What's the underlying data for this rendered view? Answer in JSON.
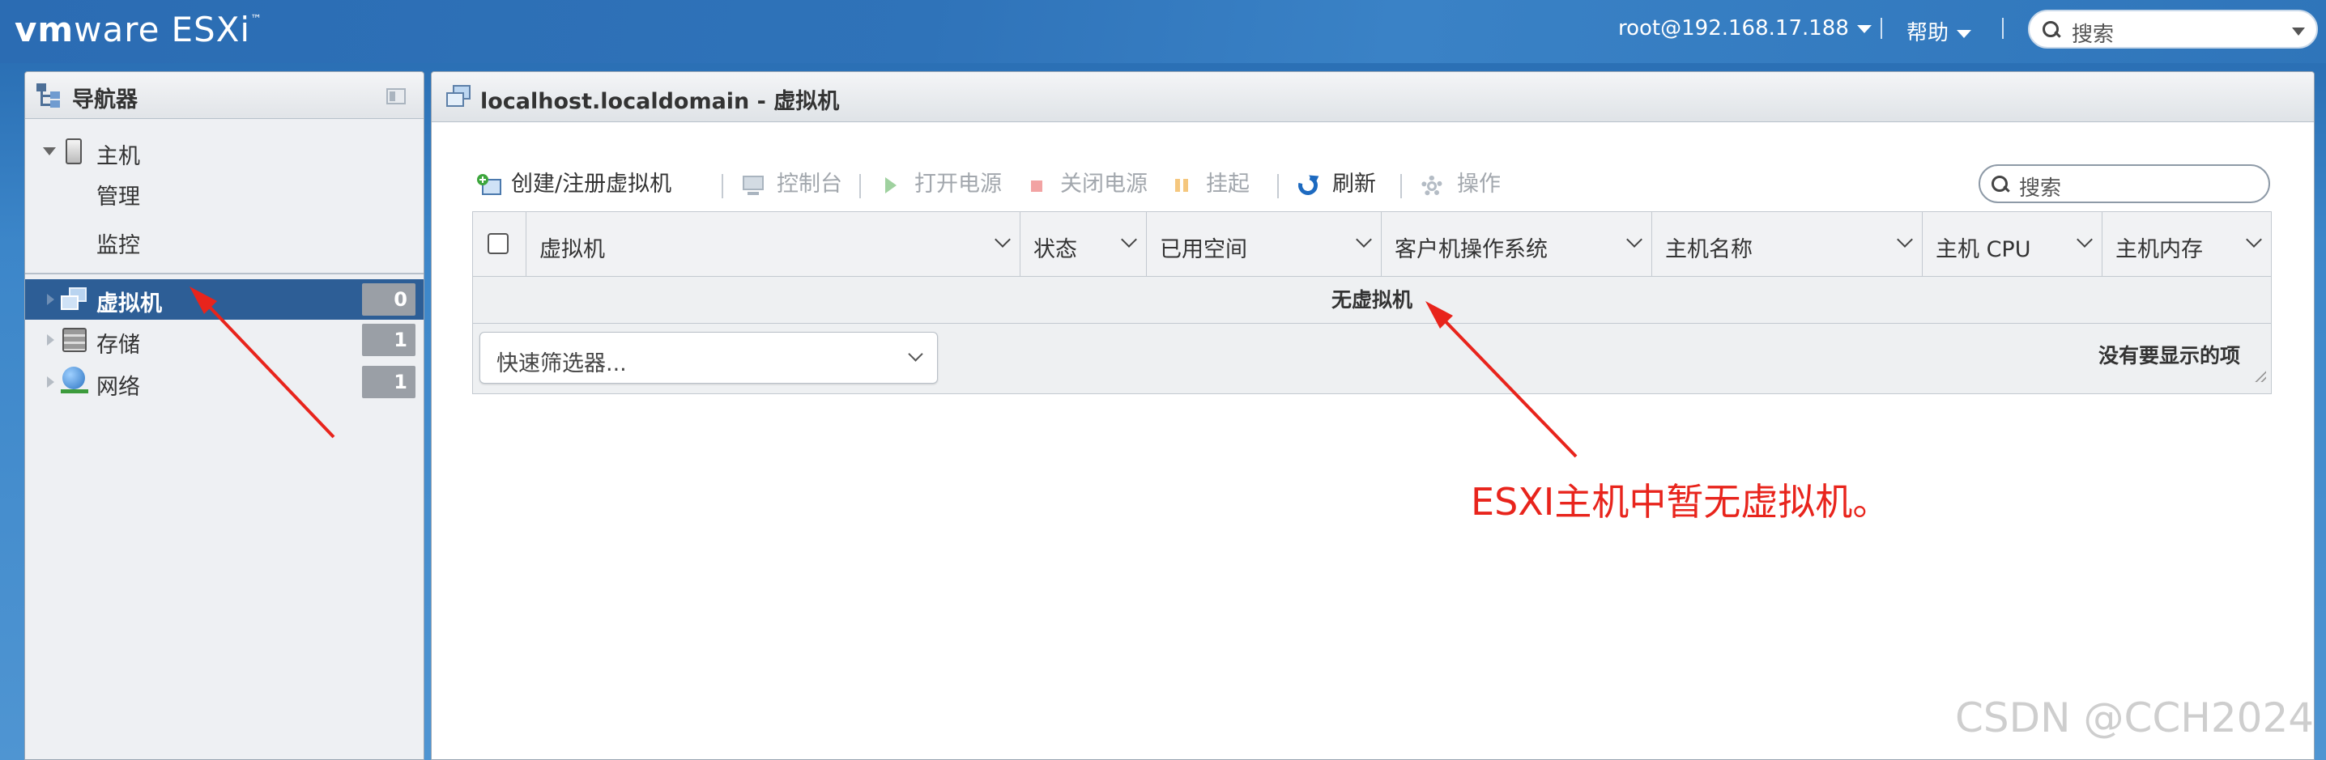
{
  "brand": {
    "vm": "vm",
    "ware": "ware",
    "product": "ESXi",
    "tm": "™"
  },
  "topbar": {
    "user": "root@192.168.17.188",
    "help": "帮助",
    "search_placeholder": "搜索"
  },
  "navigator": {
    "title": "导航器",
    "host": {
      "label": "主机",
      "children": [
        "管理",
        "监控"
      ]
    },
    "items": [
      {
        "label": "虚拟机",
        "count": "0",
        "selected": true
      },
      {
        "label": "存储",
        "count": "1",
        "selected": false
      },
      {
        "label": "网络",
        "count": "1",
        "selected": false
      }
    ]
  },
  "main": {
    "title": "localhost.localdomain - 虚拟机",
    "toolbar": {
      "create": "创建/注册虚拟机",
      "console": "控制台",
      "power_on": "打开电源",
      "power_off": "关闭电源",
      "suspend": "挂起",
      "refresh": "刷新",
      "actions": "操作"
    },
    "search_placeholder": "搜索",
    "grid": {
      "columns": [
        "虚拟机",
        "状态",
        "已用空间",
        "客户机操作系统",
        "主机名称",
        "主机 CPU",
        "主机内存"
      ],
      "empty_message": "无虚拟机",
      "quick_filter": "快速筛选器...",
      "status": "没有要显示的项"
    }
  },
  "annotation": "ESXI主机中暂无虚拟机。",
  "watermark": "CSDN @CCH2024",
  "colors": {
    "topbar": "#2f73b9",
    "selected_nav": "#2d5e96",
    "annotation": "#e8241c",
    "badge": "#9a9fa6"
  }
}
